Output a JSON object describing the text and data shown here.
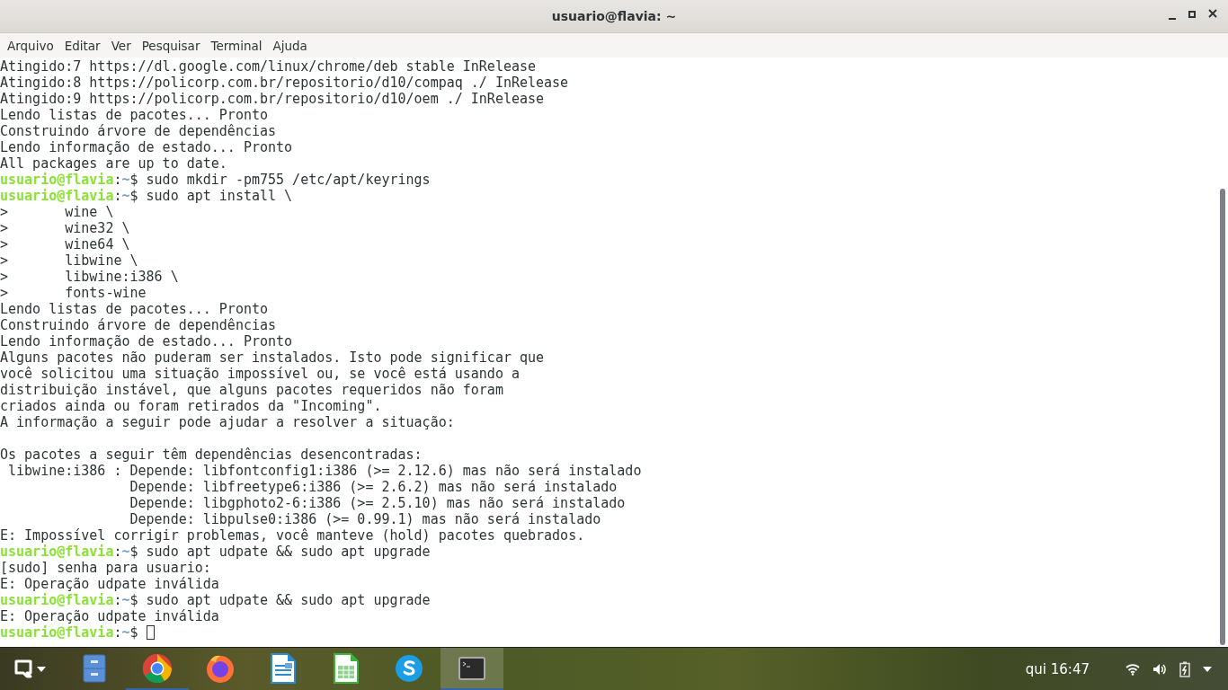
{
  "window": {
    "title": "usuario@flavia: ~"
  },
  "menu": [
    "Arquivo",
    "Editar",
    "Ver",
    "Pesquisar",
    "Terminal",
    "Ajuda"
  ],
  "terminal": {
    "lines": [
      {
        "kind": "output",
        "text": "Atingido:7 https://dl.google.com/linux/chrome/deb stable InRelease"
      },
      {
        "kind": "output",
        "text": "Atingido:8 https://policorp.com.br/repositorio/d10/compaq ./ InRelease"
      },
      {
        "kind": "output",
        "text": "Atingido:9 https://policorp.com.br/repositorio/d10/oem ./ InRelease"
      },
      {
        "kind": "output",
        "text": "Lendo listas de pacotes... Pronto"
      },
      {
        "kind": "output",
        "text": "Construindo árvore de dependências"
      },
      {
        "kind": "output",
        "text": "Lendo informação de estado... Pronto"
      },
      {
        "kind": "output",
        "text": "All packages are up to date."
      },
      {
        "kind": "prompt",
        "user": "usuario@flavia",
        "separator": ":",
        "path": "~",
        "command": "$ sudo mkdir -pm755 /etc/apt/keyrings"
      },
      {
        "kind": "prompt",
        "user": "usuario@flavia",
        "separator": ":",
        "path": "~",
        "command": "$ sudo apt install \\"
      },
      {
        "kind": "output",
        "text": ">       wine \\"
      },
      {
        "kind": "output",
        "text": ">       wine32 \\"
      },
      {
        "kind": "output",
        "text": ">       wine64 \\"
      },
      {
        "kind": "output",
        "text": ">       libwine \\"
      },
      {
        "kind": "output",
        "text": ">       libwine:i386 \\"
      },
      {
        "kind": "output",
        "text": ">       fonts-wine"
      },
      {
        "kind": "output",
        "text": "Lendo listas de pacotes... Pronto"
      },
      {
        "kind": "output",
        "text": "Construindo árvore de dependências"
      },
      {
        "kind": "output",
        "text": "Lendo informação de estado... Pronto"
      },
      {
        "kind": "output",
        "text": "Alguns pacotes não puderam ser instalados. Isto pode significar que"
      },
      {
        "kind": "output",
        "text": "você solicitou uma situação impossível ou, se você está usando a"
      },
      {
        "kind": "output",
        "text": "distribuição instável, que alguns pacotes requeridos não foram"
      },
      {
        "kind": "output",
        "text": "criados ainda ou foram retirados da \"Incoming\"."
      },
      {
        "kind": "output",
        "text": "A informação a seguir pode ajudar a resolver a situação:"
      },
      {
        "kind": "blank"
      },
      {
        "kind": "output",
        "text": "Os pacotes a seguir têm dependências desencontradas:"
      },
      {
        "kind": "output",
        "text": " libwine:i386 : Depende: libfontconfig1:i386 (>= 2.12.6) mas não será instalado"
      },
      {
        "kind": "output",
        "text": "                Depende: libfreetype6:i386 (>= 2.6.2) mas não será instalado"
      },
      {
        "kind": "output",
        "text": "                Depende: libgphoto2-6:i386 (>= 2.5.10) mas não será instalado"
      },
      {
        "kind": "output",
        "text": "                Depende: libpulse0:i386 (>= 0.99.1) mas não será instalado"
      },
      {
        "kind": "output",
        "text": "E: Impossível corrigir problemas, você manteve (hold) pacotes quebrados."
      },
      {
        "kind": "prompt",
        "user": "usuario@flavia",
        "separator": ":",
        "path": "~",
        "command": "$ sudo apt udpate && sudo apt upgrade"
      },
      {
        "kind": "output",
        "text": "[sudo] senha para usuario:"
      },
      {
        "kind": "output",
        "text": "E: Operação udpate inválida"
      },
      {
        "kind": "prompt",
        "user": "usuario@flavia",
        "separator": ":",
        "path": "~",
        "command": "$ sudo apt udpate && sudo apt upgrade"
      },
      {
        "kind": "output",
        "text": "E: Operação udpate inválida"
      },
      {
        "kind": "prompt",
        "user": "usuario@flavia",
        "separator": ":",
        "path": "~",
        "command": "$",
        "cursor": true
      }
    ]
  },
  "taskbar": {
    "apps": [
      {
        "kind": "launcher",
        "running": false,
        "active": false
      },
      {
        "kind": "files",
        "running": false,
        "active": false
      },
      {
        "kind": "chrome",
        "running": true,
        "active": false
      },
      {
        "kind": "firefox",
        "running": false,
        "active": false
      },
      {
        "kind": "writer",
        "running": false,
        "active": false
      },
      {
        "kind": "calc",
        "running": false,
        "active": false
      },
      {
        "kind": "skype",
        "running": false,
        "active": false
      },
      {
        "kind": "terminal",
        "running": true,
        "active": true
      }
    ],
    "clock": "qui 16:47"
  }
}
